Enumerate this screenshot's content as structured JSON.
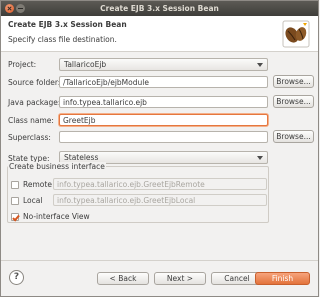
{
  "window": {
    "title": "Create EJB 3.x Session Bean"
  },
  "header": {
    "title": "Create EJB 3.x Session Bean",
    "description": "Specify class file destination."
  },
  "form": {
    "project": {
      "label": "Project:",
      "value": "TallaricoEjb"
    },
    "source_folder": {
      "label": "Source folder:",
      "value": "/TallaricoEjb/ejbModule",
      "button": "Browse..."
    },
    "java_package": {
      "label": "Java package:",
      "value": "info.typea.tallarico.ejb",
      "button": "Browse..."
    },
    "class_name": {
      "label": "Class name:",
      "value": "GreetEjb"
    },
    "superclass": {
      "label": "Superclass:",
      "value": "",
      "button": "Browse..."
    },
    "state_type": {
      "label": "State type:",
      "value": "Stateless"
    }
  },
  "business_interface": {
    "title": "Create business interface",
    "remote": {
      "label": "Remote",
      "checked": false,
      "value": "info.typea.tallarico.ejb.GreetEjbRemote"
    },
    "local": {
      "label": "Local",
      "checked": false,
      "value": "info.typea.tallarico.ejb.GreetEjbLocal"
    },
    "no_interface": {
      "label": "No-interface View",
      "checked": true
    }
  },
  "footer": {
    "help": "?",
    "back": "< Back",
    "next": "Next >",
    "cancel": "Cancel",
    "finish": "Finish"
  },
  "colors": {
    "accent": "#e3733b",
    "focus_border": "#e5773f"
  }
}
